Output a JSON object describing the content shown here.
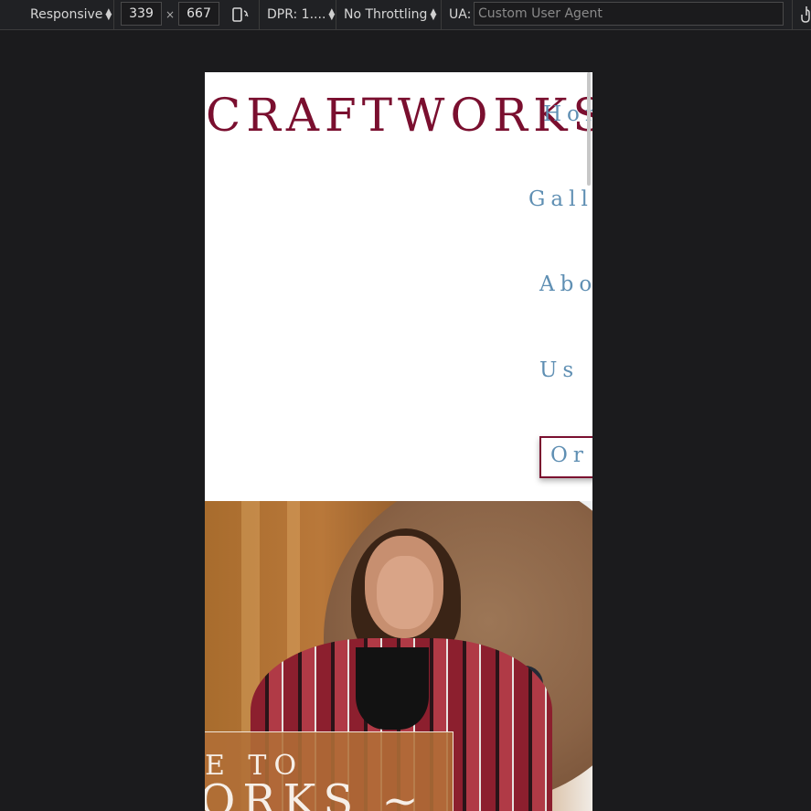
{
  "devtools": {
    "device_mode": "Responsive",
    "width": "339",
    "times": "×",
    "height": "667",
    "dpr": "DPR: 1....",
    "throttling": "No Throttling",
    "ua_label": "UA:",
    "ua_placeholder": "Custom User Agent"
  },
  "site": {
    "logo": "CRAFTWORKS",
    "nav": {
      "home": "Hom",
      "gallery": "Galle",
      "about": "Abo",
      "us": "Us",
      "order": "Or"
    },
    "hero": {
      "line1": "E TO",
      "line2": "ORKS ~"
    }
  },
  "colors": {
    "brand": "#7a0f2f",
    "nav": "#5f8fb3",
    "hero_box": "#b06e37"
  }
}
